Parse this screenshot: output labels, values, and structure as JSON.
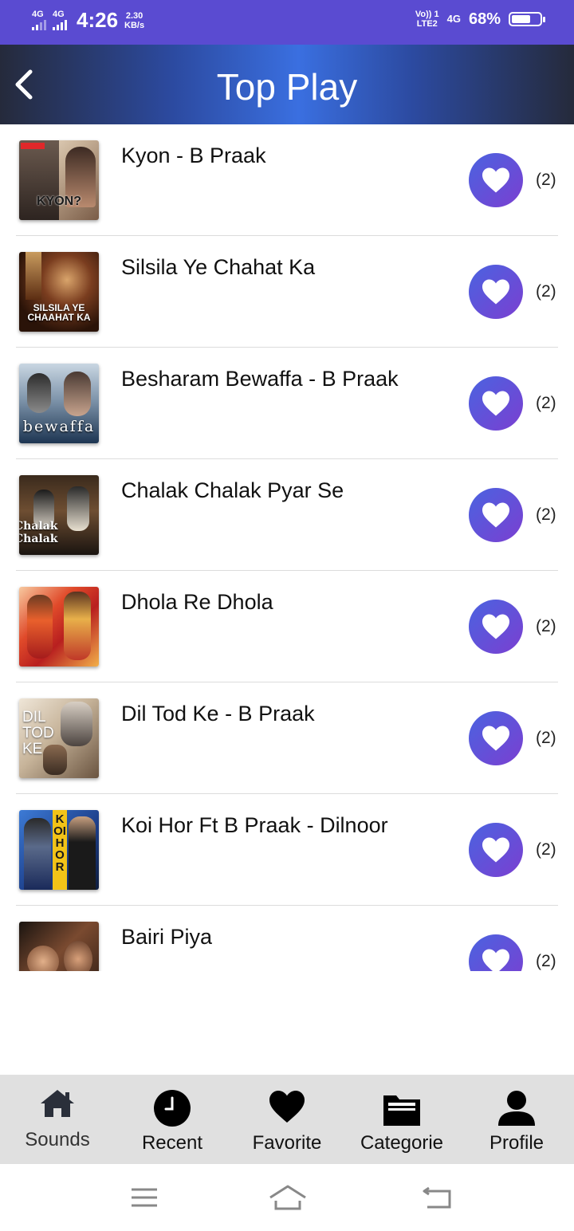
{
  "status_bar": {
    "network1": "4G",
    "network2": "4G",
    "time": "4:26",
    "speed_value": "2.30",
    "speed_unit": "KB/s",
    "volte_line1": "Vo)) 1",
    "volte_line2": "LTE2",
    "network3": "4G",
    "battery_percent": "68%",
    "battery_level": 0.68
  },
  "header": {
    "title": "Top Play",
    "back_icon": "chevron-left-icon"
  },
  "songs": [
    {
      "title": "Kyon - B Praak",
      "count": "(2)",
      "art_caption": "KYON?"
    },
    {
      "title": "Silsila Ye Chahat Ka",
      "count": "(2)",
      "art_caption": "SILSILA YE CHAAHAT KA"
    },
    {
      "title": "Besharam Bewaffa - B Praak",
      "count": "(2)",
      "art_caption": "bewaffa"
    },
    {
      "title": "Chalak Chalak Pyar Se",
      "count": "(2)",
      "art_caption": "Chalak Chalak"
    },
    {
      "title": "Dhola Re Dhola",
      "count": "(2)",
      "art_caption": ""
    },
    {
      "title": "Dil Tod Ke - B Praak",
      "count": "(2)",
      "art_caption": "DIL TOD KE"
    },
    {
      "title": "Koi Hor Ft B Praak - Dilnoor",
      "count": "(2)",
      "art_caption": "KOI HOR"
    },
    {
      "title": "Bairi Piya",
      "count": "(2)",
      "art_caption": ""
    }
  ],
  "bottom_nav": [
    {
      "label": "Sounds",
      "icon": "home-icon"
    },
    {
      "label": "Recent",
      "icon": "clock-icon"
    },
    {
      "label": "Favorite",
      "icon": "heart-icon"
    },
    {
      "label": "Categorie",
      "icon": "folder-icon"
    },
    {
      "label": "Profile",
      "icon": "person-icon"
    }
  ],
  "system_nav": [
    "menu-icon",
    "home-outline-icon",
    "back-icon"
  ],
  "colors": {
    "status_bar": "#5a4bd1",
    "accent_heart_start": "#4a63e0",
    "accent_heart_end": "#7b3fd1",
    "nav_background": "#e0e0e0"
  }
}
